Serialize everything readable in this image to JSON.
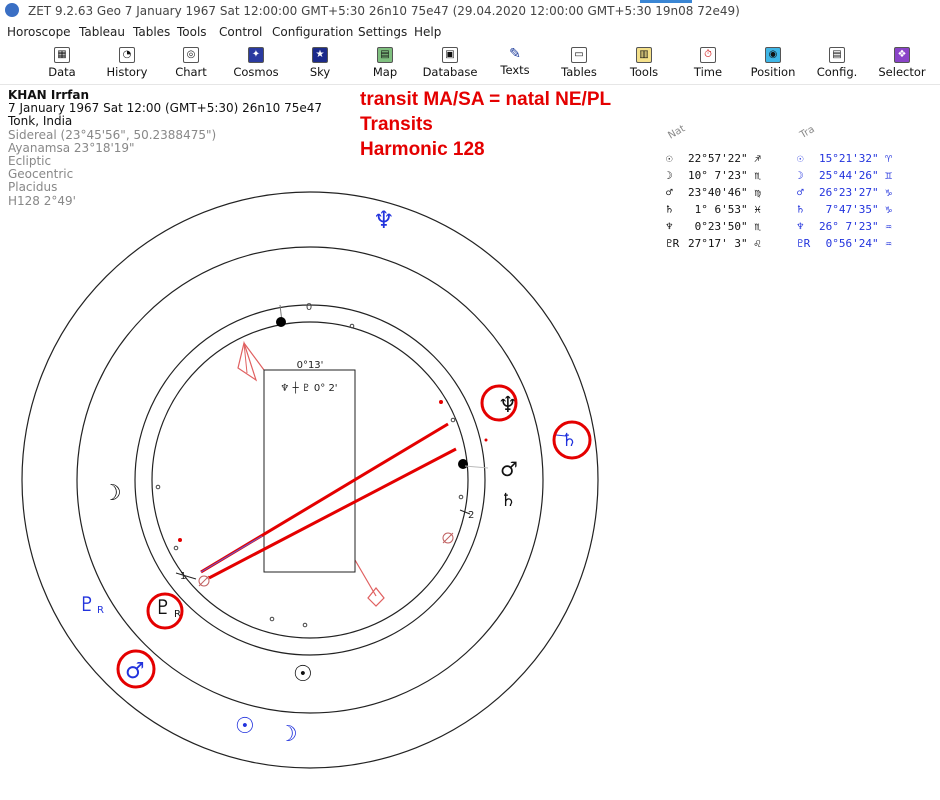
{
  "window": {
    "title": "ZET 9.2.63 Geo    7 January 1967  Sat  12:00:00 GMT+5:30 26n10  75e47  (29.04.2020  12:00:00 GMT+5:30 19n08 72e49)"
  },
  "menu": [
    "Horoscope",
    "Tableau",
    "Tables",
    "Tools",
    "Control",
    "Configuration",
    "Settings",
    "Help"
  ],
  "toolbar": [
    {
      "label": "Data",
      "icon": "table-icon"
    },
    {
      "label": "History",
      "icon": "history-icon"
    },
    {
      "label": "Chart",
      "icon": "chart-wheel-icon"
    },
    {
      "label": "Cosmos",
      "icon": "cosmos-icon"
    },
    {
      "label": "Sky",
      "icon": "sky-icon"
    },
    {
      "label": "Map",
      "icon": "map-icon"
    },
    {
      "label": "Database",
      "icon": "database-icon"
    },
    {
      "label": "Texts",
      "icon": "texts-icon"
    },
    {
      "label": "Tables",
      "icon": "tables-icon"
    },
    {
      "label": "Tools",
      "icon": "tools-icon"
    },
    {
      "label": "Time",
      "icon": "time-icon"
    },
    {
      "label": "Position",
      "icon": "position-icon"
    },
    {
      "label": "Config.",
      "icon": "config-icon"
    },
    {
      "label": "Selector",
      "icon": "selector-icon"
    }
  ],
  "info": {
    "name": "KHAN Irrfan",
    "date_line": "7 January 1967  Sat  12:00 (GMT+5:30) 26n10  75e47",
    "place": "Tonk, India",
    "zodiac": "Sidereal (23°45'56\", 50.2388475\")",
    "ayanamsa": "Ayanamsa 23°18'19\"",
    "coords": "Ecliptic",
    "centric": "Geocentric",
    "houses": "Placidus",
    "harmonic": "H128   2°49'"
  },
  "annotation": {
    "line1": "transit MA/SA = natal NE/PL",
    "line2": "Transits",
    "line3": "Harmonic 128"
  },
  "positions": {
    "natal_label": "Nat",
    "transit_label": "Tra",
    "natal": [
      {
        "glyph": "☉",
        "value": "22°57'22\" ♐"
      },
      {
        "glyph": "☽",
        "value": "10° 7'23\" ♏"
      },
      {
        "glyph": "♂",
        "value": "23°40'46\" ♍"
      },
      {
        "glyph": "♄",
        "value": " 1° 6'53\" ♓"
      },
      {
        "glyph": "♆",
        "value": " 0°23'50\" ♏"
      },
      {
        "glyph": "♇R",
        "value": "27°17' 3\" ♌"
      }
    ],
    "transit": [
      {
        "glyph": "☉",
        "value": "15°21'32\" ♈"
      },
      {
        "glyph": "☽",
        "value": "25°44'26\" ♊"
      },
      {
        "glyph": "♂",
        "value": "26°23'27\" ♑"
      },
      {
        "glyph": "♄",
        "value": " 7°47'35\" ♑"
      },
      {
        "glyph": "♆",
        "value": "26° 7'23\" ♒"
      },
      {
        "glyph": "♇R",
        "value": " 0°56'24\" ♒"
      }
    ]
  },
  "chart": {
    "inner_top_label": "0",
    "box_top_label": "0°13'",
    "box_line": "♆ ┼ ♇  0° 2'",
    "house_label_1": "1",
    "house_label_2": "2",
    "natal_glyphs": {
      "neptune": "♆",
      "saturn": "♄",
      "mars": "♂",
      "moon": "☽",
      "pluto": "♇",
      "pluto_r": "R",
      "sun": "☉"
    },
    "transit_glyphs": {
      "saturn": "♄",
      "pluto": "♇",
      "pluto_r": "R",
      "mars": "♂",
      "sun": "☉",
      "moon": "☽"
    }
  },
  "colors": {
    "annotation": "#e40000",
    "transit": "#2233dd",
    "natal": "#111111"
  }
}
